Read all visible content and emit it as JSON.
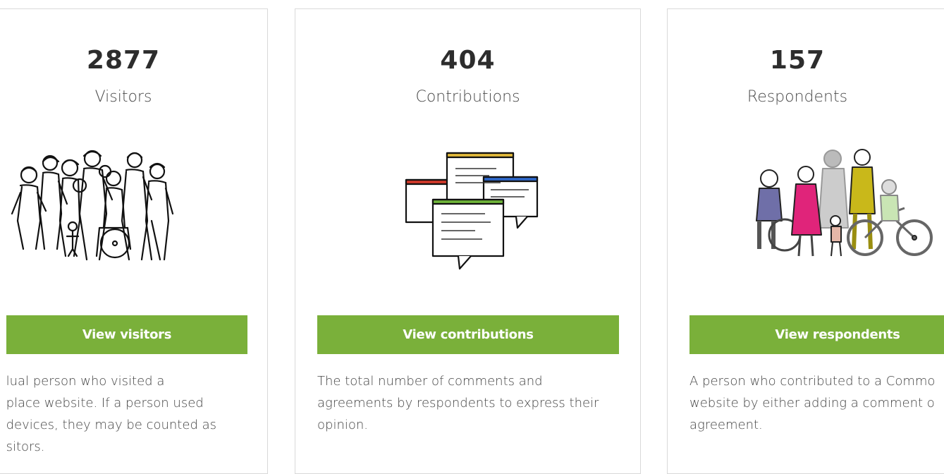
{
  "cards": [
    {
      "count": "2877",
      "label": "Visitors",
      "button": "View visitors",
      "illustration": "crowd-of-people-icon",
      "desc_lines": [
        "lual person who visited a",
        "place website. If a person used",
        "devices, they may be counted as",
        "sitors."
      ]
    },
    {
      "count": "404",
      "label": "Contributions",
      "button": "View contributions",
      "illustration": "comment-windows-icon",
      "desc_lines": [
        "The total number of comments and",
        "agreements by respondents to express their",
        "opinion."
      ]
    },
    {
      "count": "157",
      "label": "Respondents",
      "button": "View respondents",
      "illustration": "diverse-people-icon",
      "desc_lines": [
        "A person who contributed to a Commo",
        "website by either adding a comment o",
        "agreement."
      ]
    }
  ],
  "colors": {
    "button_green": "#7ab03a",
    "border": "#d9d9d9"
  }
}
